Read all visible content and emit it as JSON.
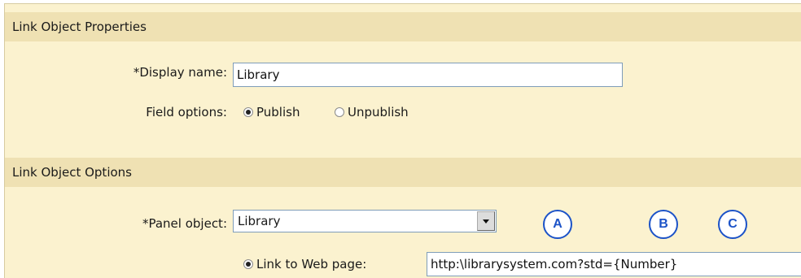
{
  "properties_section": {
    "title": "Link Object Properties",
    "display_name_label": "*Display name:",
    "display_name_value": "Library",
    "field_options_label": "Field options:",
    "publish_label": "Publish",
    "unpublish_label": "Unpublish",
    "selected_option": "Publish"
  },
  "options_section": {
    "title": "Link Object Options",
    "panel_object_label": "*Panel object:",
    "panel_object_value": "Library",
    "link_to_web_page_label": "Link to Web page:",
    "link_to_web_page_value": "http:\\librarysystem.com?std={Number}",
    "link_to_web_page_selected": true
  },
  "callouts": {
    "a": "A",
    "b": "B",
    "c": "C"
  },
  "colors": {
    "panel_background": "#fbf2cf",
    "header_background": "#efe1b3",
    "callout_blue": "#1c53c8",
    "input_border": "#7f9db9"
  }
}
